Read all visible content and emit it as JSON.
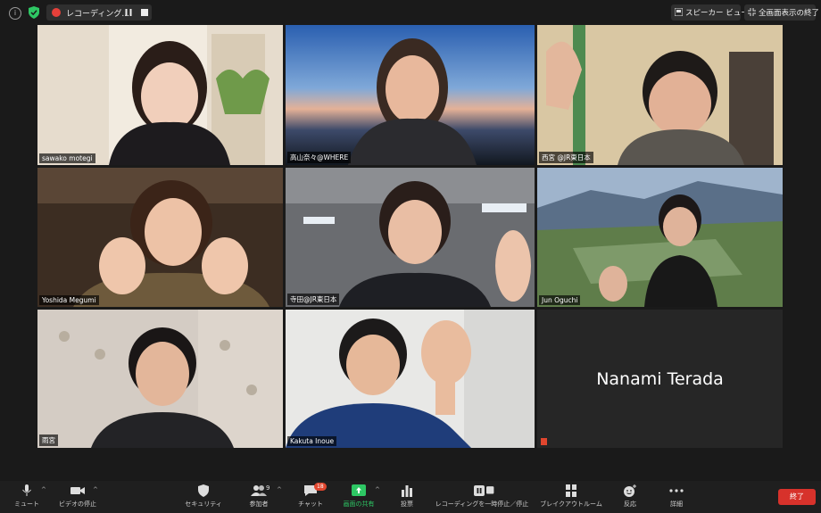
{
  "top_bar": {
    "info_icon": "info-icon",
    "shield_icon": "shield-check-icon",
    "recording_label": "レコーディング...",
    "view_label": "スピーカー ビュー",
    "fullscreen_label": "全画面表示の終了"
  },
  "participants": [
    {
      "name": "sawako motegi"
    },
    {
      "name": "高山奈々@WHERE"
    },
    {
      "name": "西宮 @JR東日本"
    },
    {
      "name": "Yoshida Megumi"
    },
    {
      "name": "寺田@JR東日本"
    },
    {
      "name": "Jun Oguchi"
    },
    {
      "name": "雨宮"
    },
    {
      "name": "Kakuta Inoue"
    },
    {
      "name": "Nanami Terada"
    }
  ],
  "toolbar": {
    "mute": "ミュート",
    "video_stop": "ビデオの停止",
    "security": "セキュリティ",
    "participants": "参加者",
    "participants_count": "9",
    "chat": "チャット",
    "chat_badge": "18",
    "share_screen": "画面の共有",
    "poll": "投票",
    "recording_pause_stop": "レコーディングを一時停止／停止",
    "breakout_rooms": "ブレイクアウトルーム",
    "reactions": "反応",
    "more": "詳細",
    "end": "終了"
  },
  "colors": {
    "active_speaker": "#c7e14a",
    "share_green": "#2ec764",
    "end_red": "#d7322b",
    "record_red": "#e6403a"
  }
}
